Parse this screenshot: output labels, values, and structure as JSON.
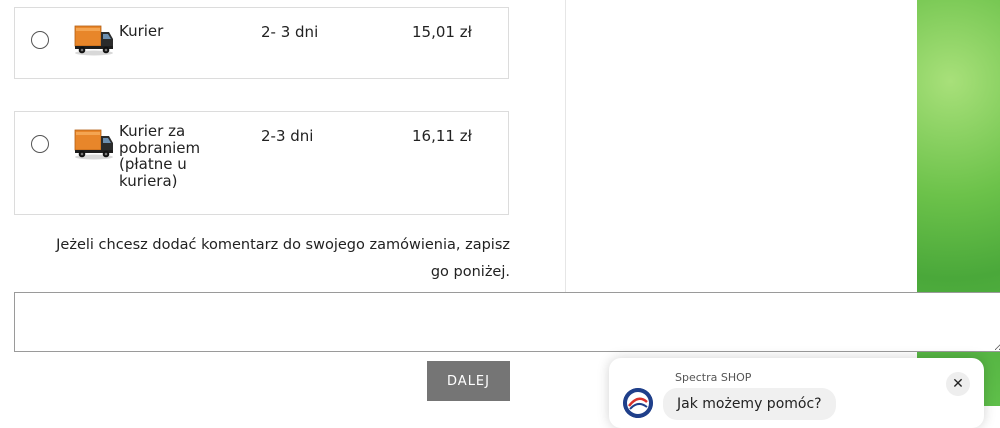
{
  "shipping_options": [
    {
      "name": "Kurier",
      "time": "2- 3 dni",
      "price": "15,01 zł",
      "icon": "truck-icon"
    },
    {
      "name": "Kurier za pobraniem (płatne u kuriera)",
      "time": "2-3 dni",
      "price": "16,11 zł",
      "icon": "truck-icon"
    }
  ],
  "comment": {
    "note": "Jeżeli chcesz dodać komentarz do swojego zamówienia, zapisz go poniżej.",
    "value": "",
    "placeholder": ""
  },
  "next_button": {
    "label": "DALEJ"
  },
  "chat": {
    "title": "Spectra SHOP",
    "message": "Jak możemy pomóc?",
    "close_icon": "close-icon"
  },
  "colors": {
    "button_bg": "#757575",
    "side_panel": "#5fbf4a"
  }
}
